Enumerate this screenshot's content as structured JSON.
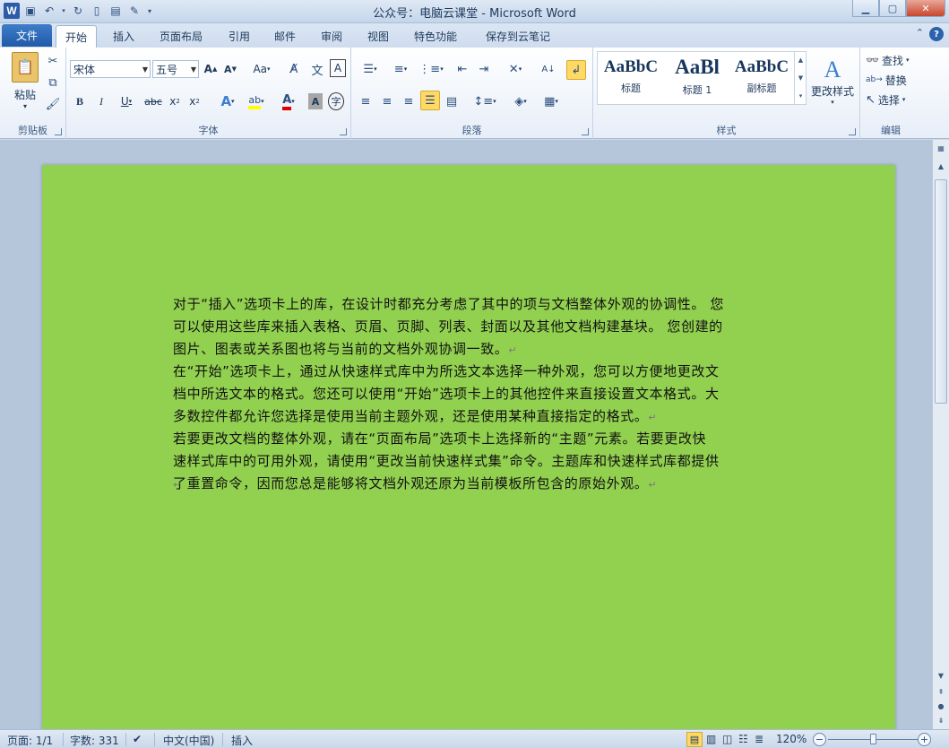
{
  "window": {
    "title": "公众号：电脑云课堂 - Microsoft Word",
    "app_badge": "W"
  },
  "ribbon_tabs": [
    "文件",
    "开始",
    "插入",
    "页面布局",
    "引用",
    "邮件",
    "审阅",
    "视图",
    "特色功能",
    "保存到云笔记"
  ],
  "groups": {
    "clipboard": {
      "label": "剪贴板",
      "paste": "粘贴"
    },
    "font": {
      "label": "字体",
      "font_name": "宋体",
      "font_size": "五号"
    },
    "paragraph": {
      "label": "段落"
    },
    "styles": {
      "label": "样式",
      "items": [
        {
          "sample": "AaBbC",
          "name": "标题"
        },
        {
          "sample": "AaBl",
          "name": "标题 1"
        },
        {
          "sample": "AaBbC",
          "name": "副标题"
        }
      ],
      "change_styles": "更改样式"
    },
    "editing": {
      "label": "编辑",
      "find": "查找",
      "replace": "替换",
      "select": "选择"
    }
  },
  "document": {
    "paragraphs": [
      [
        "对于“插入”选项卡上的库，在设计时都充分考虑了其中的项与文档整体外观的协调性。 您",
        "可以使用这些库来插入表格、页眉、页脚、列表、封面以及其他文档构建基块。 您创建的",
        "图片、图表或关系图也将与当前的文档外观协调一致。"
      ],
      [
        "在“开始”选项卡上，通过从快速样式库中为所选文本选择一种外观，您可以方便地更改文",
        "档中所选文本的格式。您还可以使用“开始”选项卡上的其他控件来直接设置文本格式。大",
        "多数控件都允许您选择是使用当前主题外观，还是使用某种直接指定的格式。"
      ],
      [
        "若要更改文档的整体外观，请在“页面布局”选项卡上选择新的“主题”元素。若要更改快",
        "速样式库中的可用外观，请使用“更改当前快速样式集”命令。主题库和快速样式库都提供",
        "了重置命令，因而您总是能够将文档外观还原为当前模板所包含的原始外观。"
      ]
    ],
    "paragraph_mark": "↵",
    "page_color": "#92d050"
  },
  "statusbar": {
    "page": "页面: 1/1",
    "words": "字数: 331",
    "language": "中文(中国)",
    "mode": "插入",
    "zoom": "120%"
  }
}
